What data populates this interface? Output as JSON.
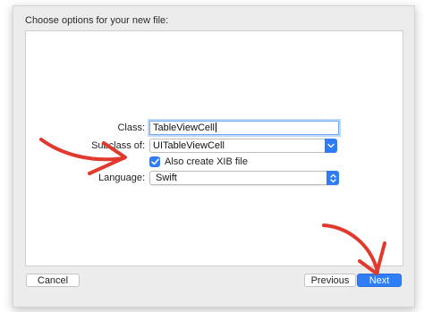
{
  "dialog": {
    "heading": "Choose options for your new file:"
  },
  "form": {
    "class_label": "Class:",
    "class_value": "TableViewCell",
    "subclass_label": "Subclass of:",
    "subclass_value": "UITableViewCell",
    "xib_label": "Also create XIB file",
    "xib_checked": true,
    "language_label": "Language:",
    "language_value": "Swift"
  },
  "footer": {
    "cancel_label": "Cancel",
    "previous_label": "Previous",
    "next_label": "Next"
  },
  "colors": {
    "accent": "#2e7cf6",
    "annotation": "#e0392e"
  },
  "icons": {
    "combo": "chevron-down-icon",
    "popup": "up-down-chevron-icon",
    "checkbox": "checkmark-icon",
    "annotations": "hand-drawn-arrow-icon"
  }
}
